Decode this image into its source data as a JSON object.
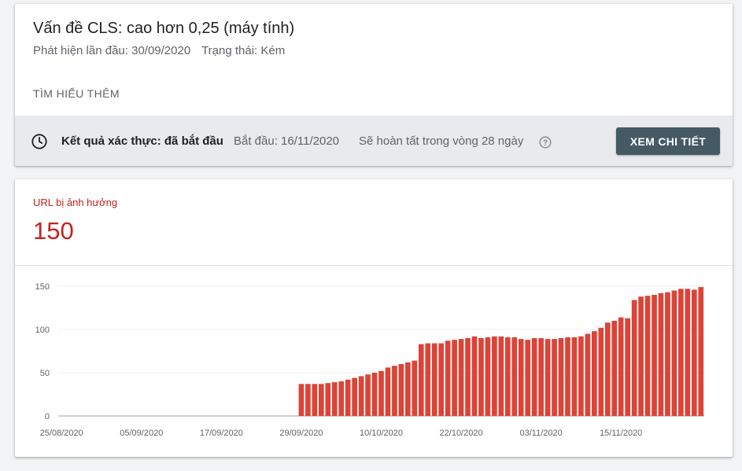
{
  "issue": {
    "title": "Vấn đề CLS: cao hơn 0,25 (máy tính)",
    "first_detected": "Phát hiện lần đầu: 30/09/2020",
    "status": "Trạng thái: Kém",
    "learn_more": "Tìm hiểu thêm"
  },
  "validation": {
    "icon": "clock-icon",
    "label": "Kết quả xác thực: đã bắt đầu",
    "start": "Bắt đầu: 16/11/2020",
    "completion": "Sẽ hoàn tất trong vòng 28 ngày",
    "help_icon": "help-circle-icon",
    "details_button": "Xem chi tiết",
    "button_color": "#455a64"
  },
  "metric": {
    "label": "URL bị ảnh hưởng",
    "value": "150",
    "accent_color": "#c5221f"
  },
  "chart_data": {
    "type": "bar",
    "bar_color": "#db4437",
    "ylim": [
      0,
      150
    ],
    "yticks": [
      0,
      50,
      100,
      150
    ],
    "x_start": "25/08/2020",
    "xtick_labels": [
      "25/08/2020",
      "05/09/2020",
      "17/09/2020",
      "29/09/2020",
      "10/10/2020",
      "22/10/2020",
      "03/11/2020",
      "15/11/2020"
    ],
    "grid": true,
    "values": [
      0,
      0,
      0,
      0,
      0,
      0,
      0,
      0,
      0,
      0,
      0,
      0,
      0,
      0,
      0,
      0,
      0,
      0,
      0,
      0,
      0,
      0,
      0,
      0,
      0,
      0,
      0,
      0,
      0,
      0,
      0,
      0,
      0,
      0,
      0,
      0,
      37,
      37,
      37,
      37,
      38,
      39,
      40,
      42,
      44,
      46,
      48,
      50,
      52,
      56,
      58,
      60,
      62,
      64,
      83,
      84,
      84,
      84,
      87,
      88,
      89,
      90,
      92,
      90,
      91,
      92,
      92,
      91,
      91,
      89,
      88,
      90,
      90,
      89,
      89,
      90,
      91,
      91,
      92,
      95,
      98,
      102,
      108,
      110,
      114,
      113,
      134,
      138,
      139,
      140,
      142,
      143,
      145,
      147,
      147,
      146,
      149
    ]
  }
}
